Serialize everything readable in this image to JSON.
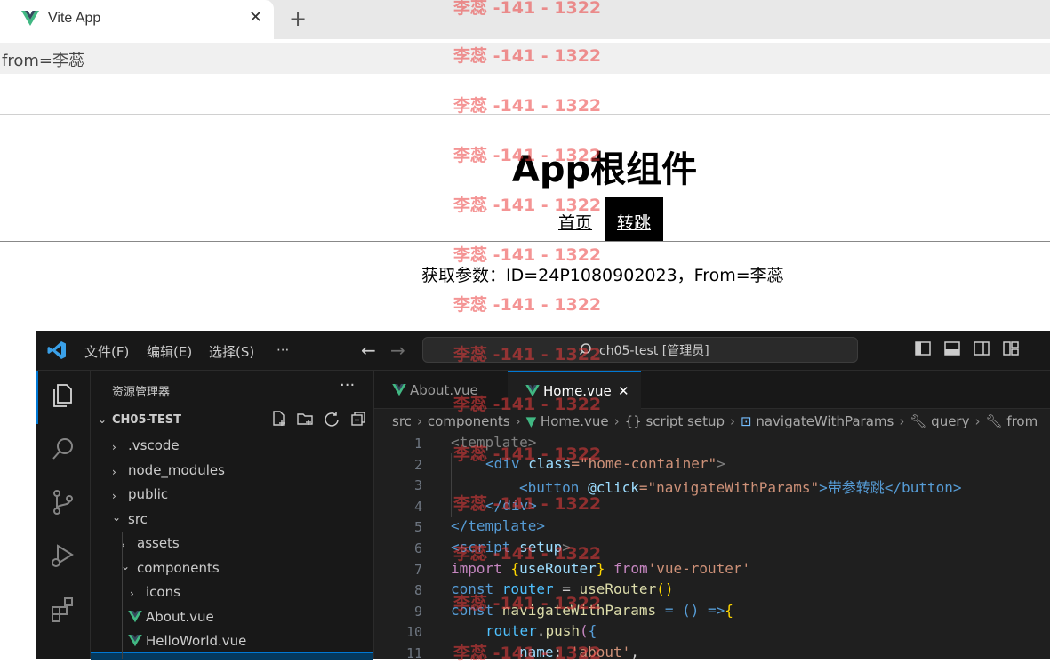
{
  "browser": {
    "tab_title": "Vite App",
    "tab_close": "✕",
    "new_tab": "+",
    "address": "from=李蕊"
  },
  "page": {
    "title": "App根组件",
    "nav_home": "首页",
    "nav_jump": "转跳",
    "params_text": "获取参数：ID=24P1080902023，From=李蕊"
  },
  "watermark": "李蕊 -141 - 1322",
  "vscode": {
    "menu": [
      "文件(F)",
      "编辑(E)",
      "选择(S)",
      "···"
    ],
    "command_center": "ch05-test [管理员]",
    "explorer_header": "资源管理器",
    "explorer_more": "···",
    "project_name": "CH05-TEST",
    "tree": [
      {
        "label": ".vscode",
        "chev": "›"
      },
      {
        "label": "node_modules",
        "chev": "›"
      },
      {
        "label": "public",
        "chev": "›"
      },
      {
        "label": "src",
        "chev": "⌄"
      },
      {
        "label": "assets",
        "chev": "›"
      },
      {
        "label": "components",
        "chev": "⌄"
      },
      {
        "label": "icons",
        "chev": "›"
      },
      {
        "label": "About.vue",
        "chev": ""
      },
      {
        "label": "HelloWorld.vue",
        "chev": ""
      }
    ],
    "tabs": [
      {
        "label": "About.vue"
      },
      {
        "label": "Home.vue",
        "close": "✕"
      }
    ],
    "breadcrumb": [
      "src",
      "components",
      "Home.vue",
      "{} script setup",
      "navigateWithParams",
      "query",
      "from"
    ],
    "line_numbers": [
      "1",
      "2",
      "3",
      "4",
      "5",
      "6",
      "7",
      "8",
      "9",
      "10",
      "11"
    ],
    "code": {
      "l1": "<template>",
      "l2a": "<div ",
      "l2b": "class",
      "l2c": "=\"home-container\"",
      "l2d": ">",
      "l3a": "<button ",
      "l3b": "@click",
      "l3c": "=\"navigateWithParams\"",
      "l3d": ">带参转跳</button>",
      "l4": "</div>",
      "l5": "</template>",
      "l6a": "<script ",
      "l6b": "setup",
      "l6c": ">",
      "l7a": "import ",
      "l7b": "{",
      "l7c": "useRouter",
      "l7d": "} ",
      "l7e": "from",
      "l7f": "'vue-router'",
      "l8a": "const ",
      "l8b": "router",
      "l8c": " = ",
      "l8d": "useRouter",
      "l8e": "()",
      "l9a": "const ",
      "l9b": "navigateWithParams",
      "l9c": " = () =>",
      "l9d": "{",
      "l10a": "router",
      "l10b": ".",
      "l10c": "push",
      "l10d": "(",
      "l10e": "{",
      "l11a": "name",
      "l11b": ": ",
      "l11c": "'about'",
      "l11d": ","
    }
  },
  "colors": {
    "accent": "#0078d4",
    "vue_green": "#41b883",
    "watermark": "#eb3c3c"
  }
}
